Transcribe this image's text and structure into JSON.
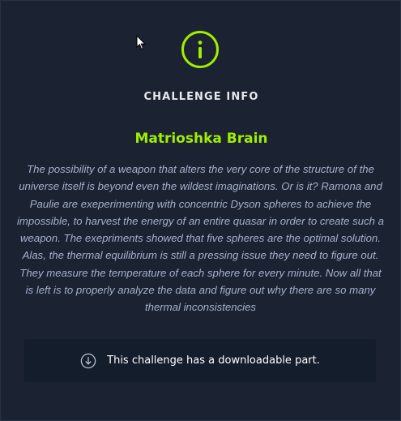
{
  "modal": {
    "icon": "info-icon",
    "heading": "CHALLENGE INFO",
    "challenge_name": "Matrioshka Brain",
    "description": "The possibility of a weapon that alters the very core of the structure of the universe itself is beyond even the wildest imaginations. Or is it? Ramona and Paulie are exeperimenting with concentric Dyson spheres to achieve the impossible, to harvest the energy of an entire quasar in order to create such a weapon. The exepriments showed that five spheres are the optimal solution. Alas, the thermal equilibrium is still a pressing issue they need to figure out. They measure the temperature of each sphere for every minute. Now all that is left is to properly analyze the data and figure out why there are so many thermal inconsistencies",
    "download": {
      "icon": "download-icon",
      "text": "This challenge has a downloadable part."
    }
  },
  "colors": {
    "background": "#1b2231",
    "accent": "#9fef00",
    "description_text": "#a4b1cd",
    "download_bar": "#141d2b"
  }
}
